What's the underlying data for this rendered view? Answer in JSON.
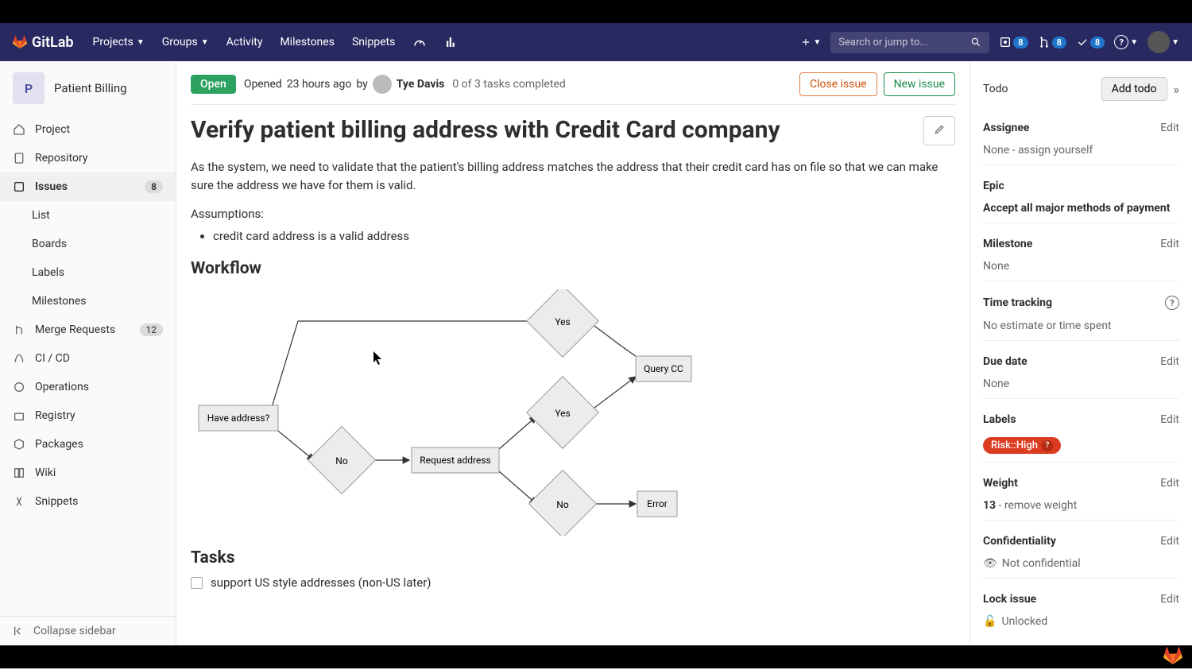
{
  "brand": "GitLab",
  "topnav": {
    "items": [
      "Projects",
      "Groups",
      "Activity",
      "Milestones",
      "Snippets"
    ],
    "search_placeholder": "Search or jump to...",
    "badges": {
      "issues": "8",
      "mr": "8",
      "todos": "8"
    }
  },
  "sidebar": {
    "project_initial": "P",
    "project_name": "Patient Billing",
    "items": [
      {
        "label": "Project"
      },
      {
        "label": "Repository"
      },
      {
        "label": "Issues",
        "badge": "8",
        "active": true
      },
      {
        "label": "Merge Requests",
        "badge": "12"
      },
      {
        "label": "CI / CD"
      },
      {
        "label": "Operations"
      },
      {
        "label": "Registry"
      },
      {
        "label": "Packages"
      },
      {
        "label": "Wiki"
      },
      {
        "label": "Snippets"
      }
    ],
    "issue_subs": [
      "List",
      "Boards",
      "Labels",
      "Milestones"
    ],
    "collapse": "Collapse sidebar"
  },
  "issue": {
    "status": "Open",
    "opened_prefix": "Opened",
    "opened_time": "23 hours ago",
    "by": "by",
    "author": "Tye Davis",
    "task_progress": "0 of 3 tasks completed",
    "close_btn": "Close issue",
    "new_btn": "New issue",
    "title": "Verify patient billing address with Credit Card company",
    "description": "As the system, we need to validate that the patient's billing address matches the address that their credit card has on file so that we can make sure the address we have for them is valid.",
    "assumptions_heading": "Assumptions:",
    "assumptions": [
      "credit card address is a valid address"
    ],
    "workflow_heading": "Workflow",
    "tasks_heading": "Tasks",
    "tasks": [
      "support US style addresses (non-US later)"
    ]
  },
  "diagram": {
    "nodes": {
      "have_address": "Have address?",
      "yes1": "Yes",
      "no1": "No",
      "request_address": "Request address",
      "yes2": "Yes",
      "no2": "No",
      "query_cc": "Query CC",
      "error": "Error"
    }
  },
  "rightbar": {
    "todo_label": "Todo",
    "add_todo": "Add todo",
    "assignee_label": "Assignee",
    "assignee_value": "None - assign yourself",
    "epic_label": "Epic",
    "epic_value": "Accept all major methods of payment",
    "milestone_label": "Milestone",
    "milestone_value": "None",
    "time_label": "Time tracking",
    "time_value": "No estimate or time spent",
    "due_label": "Due date",
    "due_value": "None",
    "labels_label": "Labels",
    "label_pill": "Risk::High",
    "weight_label": "Weight",
    "weight_value_num": "13",
    "weight_value_rest": " - remove weight",
    "conf_label": "Confidentiality",
    "conf_value": "Not confidential",
    "lock_label": "Lock issue",
    "lock_value": "Unlocked",
    "edit": "Edit"
  }
}
